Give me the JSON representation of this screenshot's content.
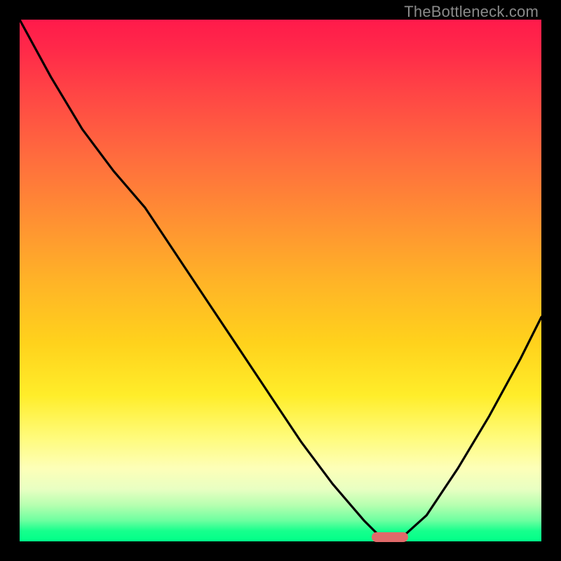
{
  "watermark": "TheBottleneck.com",
  "chart_data": {
    "type": "line",
    "title": "",
    "xlabel": "",
    "ylabel": "",
    "x": [
      0.0,
      0.06,
      0.12,
      0.18,
      0.24,
      0.3,
      0.36,
      0.42,
      0.48,
      0.54,
      0.6,
      0.66,
      0.695,
      0.73,
      0.78,
      0.84,
      0.9,
      0.96,
      1.0
    ],
    "y": [
      1.0,
      0.89,
      0.79,
      0.71,
      0.64,
      0.55,
      0.46,
      0.37,
      0.28,
      0.19,
      0.11,
      0.04,
      0.005,
      0.005,
      0.05,
      0.14,
      0.24,
      0.35,
      0.43
    ],
    "xlim": [
      0,
      1
    ],
    "ylim": [
      0,
      1
    ],
    "marker": {
      "x_center": 0.71,
      "width_frac": 0.07,
      "y": 0.005
    }
  },
  "colors": {
    "curve": "#000000",
    "marker": "#e06a6a"
  }
}
